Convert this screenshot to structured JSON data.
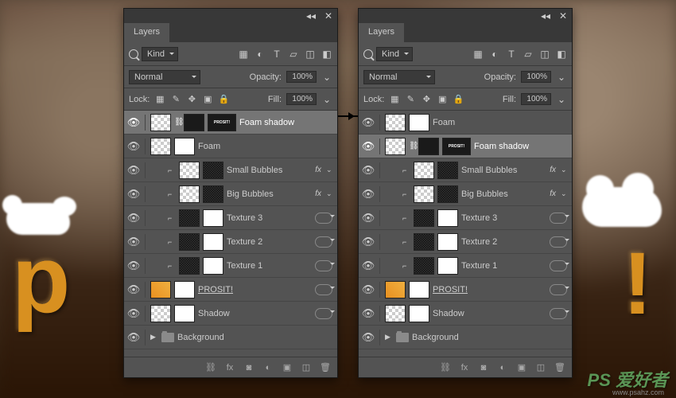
{
  "panel_title": "Layers",
  "filter": {
    "kind": "Kind"
  },
  "blend": {
    "mode": "Normal",
    "opacity_label": "Opacity:",
    "opacity": "100%"
  },
  "lock": {
    "label": "Lock:",
    "fill_label": "Fill:",
    "fill": "100%"
  },
  "layers_left": [
    {
      "name": "Foam shadow",
      "selected": true,
      "thumbs": [
        "checker",
        "dark"
      ],
      "link": true,
      "mini": "PROSIT!",
      "fx": false,
      "od": false
    },
    {
      "name": "Foam",
      "thumbs": [
        "checker",
        "mask"
      ],
      "fx": false,
      "od": false
    },
    {
      "name": "Small Bubbles",
      "indent": 1,
      "clip": true,
      "thumbs": [
        "checker",
        "tex"
      ],
      "fx": true,
      "od": false
    },
    {
      "name": "Big Bubbles",
      "indent": 1,
      "clip": true,
      "thumbs": [
        "checker",
        "tex"
      ],
      "fx": true,
      "od": false
    },
    {
      "name": "Texture 3",
      "indent": 1,
      "clip": true,
      "thumbs": [
        "tex",
        "mask"
      ],
      "od": true
    },
    {
      "name": "Texture 2",
      "indent": 1,
      "clip": true,
      "thumbs": [
        "tex",
        "mask"
      ],
      "od": true
    },
    {
      "name": "Texture 1",
      "indent": 1,
      "clip": true,
      "thumbs": [
        "tex",
        "mask"
      ],
      "od": true
    },
    {
      "name": "PROSIT!",
      "thumbs": [
        "yellow",
        "mask"
      ],
      "underline": true,
      "od": true
    },
    {
      "name": "Shadow",
      "thumbs": [
        "checker",
        "mask"
      ],
      "od": true
    },
    {
      "name": "Background",
      "folder": true
    }
  ],
  "layers_right": [
    {
      "name": "Foam",
      "thumbs": [
        "checker",
        "mask"
      ],
      "fx": false,
      "od": false
    },
    {
      "name": "Foam shadow",
      "selected": true,
      "thumbs": [
        "checker",
        "dark"
      ],
      "link": true,
      "mini": "PROSIT!",
      "fx": false,
      "od": false
    },
    {
      "name": "Small Bubbles",
      "indent": 1,
      "clip": true,
      "thumbs": [
        "checker",
        "tex"
      ],
      "fx": true,
      "od": false
    },
    {
      "name": "Big Bubbles",
      "indent": 1,
      "clip": true,
      "thumbs": [
        "checker",
        "tex"
      ],
      "fx": true,
      "od": false
    },
    {
      "name": "Texture 3",
      "indent": 1,
      "clip": true,
      "thumbs": [
        "tex",
        "mask"
      ],
      "od": true
    },
    {
      "name": "Texture 2",
      "indent": 1,
      "clip": true,
      "thumbs": [
        "tex",
        "mask"
      ],
      "od": true
    },
    {
      "name": "Texture 1",
      "indent": 1,
      "clip": true,
      "thumbs": [
        "tex",
        "mask"
      ],
      "od": true
    },
    {
      "name": "PROSIT!",
      "thumbs": [
        "yellow",
        "mask"
      ],
      "underline": true,
      "od": true
    },
    {
      "name": "Shadow",
      "thumbs": [
        "checker",
        "mask"
      ],
      "od": true
    },
    {
      "name": "Background",
      "folder": true
    }
  ],
  "watermark": {
    "main": "PS 爱好者",
    "sub": "www.psahz.com"
  }
}
